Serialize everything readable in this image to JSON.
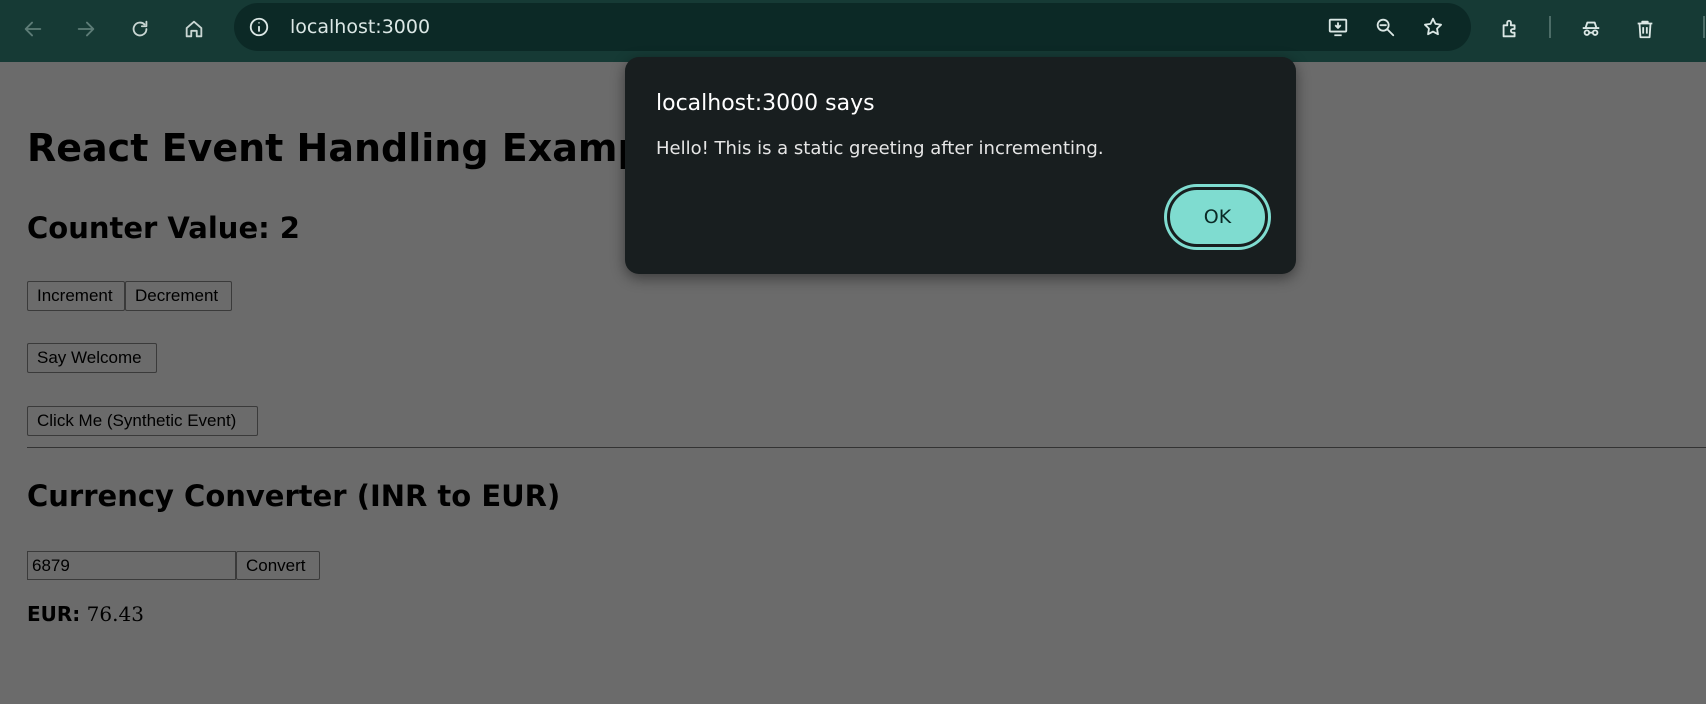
{
  "browser": {
    "url": "localhost:3000"
  },
  "page": {
    "heading": "React Event Handling Example",
    "counter_label": "Counter Value: 2",
    "increment_label": "Increment",
    "decrement_label": "Decrement",
    "welcome_label": "Say Welcome",
    "synthetic_label": "Click Me (Synthetic Event)",
    "converter_heading": "Currency Converter (INR to EUR)",
    "amount_value": "6879",
    "convert_label": "Convert",
    "result_label": "EUR:",
    "result_value": "76.43"
  },
  "dialog": {
    "title": "localhost:3000 says",
    "message": "Hello! This is a static greeting after incrementing.",
    "ok_label": "OK"
  },
  "colors": {
    "toolbar": "#163a35",
    "omnibox": "#0c2926",
    "page_dimmed": "#6b6b6b",
    "dialog_bg": "#181e1f",
    "ok_button": "#7fdcd0"
  }
}
